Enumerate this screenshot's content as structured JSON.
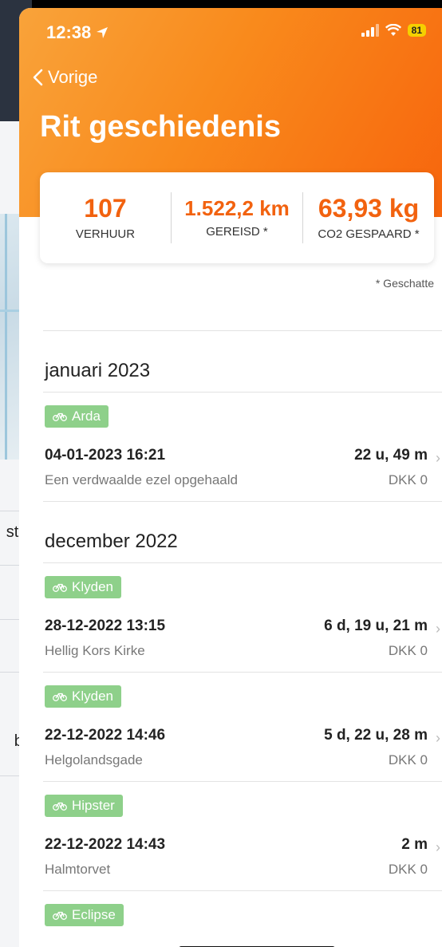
{
  "status_bar": {
    "time": "12:38",
    "battery": "81"
  },
  "nav": {
    "back_label": "Vorige",
    "title": "Rit geschiedenis"
  },
  "stats": [
    {
      "value": "107",
      "label": "VERHUUR"
    },
    {
      "value": "1.522,2 km",
      "label": "GEREISD *"
    },
    {
      "value": "63,93 kg",
      "label": "CO2 GESPAARD *"
    }
  ],
  "estimate_note": "* Geschatte",
  "background": {
    "fragment_1": "st h",
    "fragment_2": "be"
  },
  "sections": [
    {
      "month": "januari 2023",
      "rides": [
        {
          "bike": "Arda",
          "datetime": "04-01-2023 16:21",
          "duration": "22 u, 49 m",
          "place": "Een verdwaalde ezel opgehaald",
          "price": "DKK 0"
        }
      ]
    },
    {
      "month": "december 2022",
      "rides": [
        {
          "bike": "Klyden",
          "datetime": "28-12-2022 13:15",
          "duration": "6 d, 19 u, 21 m",
          "place": "Hellig Kors Kirke",
          "price": "DKK 0"
        },
        {
          "bike": "Klyden",
          "datetime": "22-12-2022 14:46",
          "duration": "5 d, 22 u, 28 m",
          "place": "Helgolandsgade",
          "price": "DKK 0"
        },
        {
          "bike": "Hipster",
          "datetime": "22-12-2022 14:43",
          "duration": "2 m",
          "place": "Halmtorvet",
          "price": "DKK 0"
        },
        {
          "bike": "Eclipse"
        }
      ]
    }
  ],
  "colors": {
    "accent": "#f2620f",
    "bike_tag": "#8ed08a"
  }
}
